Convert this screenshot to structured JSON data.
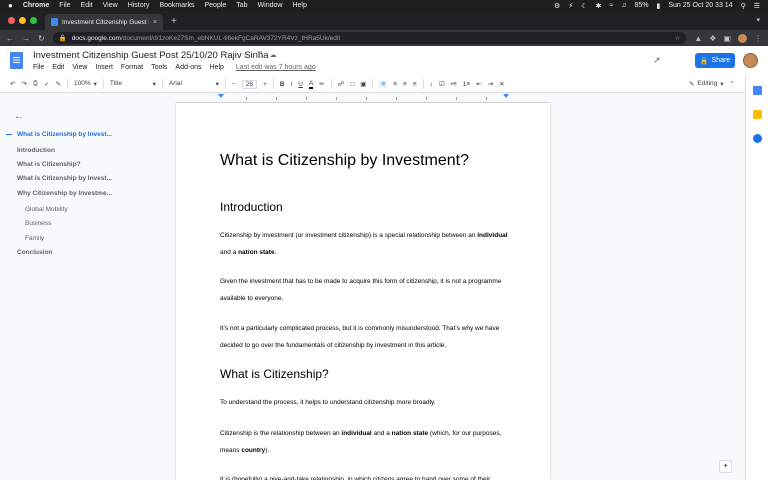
{
  "macbar": {
    "apple": "",
    "menus": [
      "Chrome",
      "File",
      "Edit",
      "View",
      "History",
      "Bookmarks",
      "People",
      "Tab",
      "Window",
      "Help"
    ],
    "battery": "85%",
    "datetime": "Sun 25 Oct  20 33 14"
  },
  "browser": {
    "tab_title": "Investment Citizenship Guest P",
    "tab_close": "×",
    "new_tab": "+",
    "url_host": "docs.google.com",
    "url_path": "/document/d/1zoKe27Sm_ebNKUL-ti6ekFgCaRAV372YR4Vz_tHRa5Uk/edit",
    "lock": "🔒"
  },
  "doc": {
    "title": "Investment Citizenship Guest Post 25/10/20 Rajiv Sinha",
    "menus": [
      "File",
      "Edit",
      "View",
      "Insert",
      "Format",
      "Tools",
      "Add-ons",
      "Help"
    ],
    "last_edit": "Last edit was 7 hours ago",
    "share_label": "Share"
  },
  "toolbar": {
    "zoom": "100%",
    "style": "Title",
    "font": "Arial",
    "size": "26",
    "minus": "−",
    "plus": "+",
    "bold": "B",
    "italic": "I",
    "underline": "U",
    "text_color": "A",
    "mode": "Editing"
  },
  "outline": {
    "back": "←",
    "items": [
      {
        "label": "What is Citizenship by Invest...",
        "level": 1,
        "active": true
      },
      {
        "label": "Introduction",
        "level": 1
      },
      {
        "label": "What is Citizenship?",
        "level": 1
      },
      {
        "label": "What is Citizenship by Invest...",
        "level": 1
      },
      {
        "label": "Why Citizenship by Investme...",
        "level": 1
      },
      {
        "label": "Global Mobility",
        "level": 2
      },
      {
        "label": "Business",
        "level": 2
      },
      {
        "label": "Family",
        "level": 2
      },
      {
        "label": "Conclusion",
        "level": 1
      }
    ]
  },
  "content": {
    "title": "What is Citizenship by Investment?",
    "h_intro": "Introduction",
    "p1_a": "Citizenship by investment (or investment citizenship) is a special relationship between an ",
    "p1_b": "individual",
    "p1_c": " and a ",
    "p1_d": "nation state",
    "p1_e": ".",
    "p2": "Given the investment that has to be made to acquire this form of citizenship, it is not a programme available to everyone.",
    "p3": "It’s not a particularly complicated process, but it is commonly misunderstood.  That’s why we have decided to go over the fundamentals of citizenship by investment in this article.",
    "h_citizenship": "What is Citizenship?",
    "p4": "To understand the process, it helps to understand citizenship more broadly.",
    "p5_a": "Citizenship is the relationship between an ",
    "p5_b": "individual",
    "p5_c": " and a ",
    "p5_d": "nation state",
    "p5_e": " (which, for our purposes, means ",
    "p5_f": "country",
    "p5_g": ").",
    "p6": "It is (hopefully) a give-and-take relationship, in which citizens agree to hand over some of their"
  },
  "colors": {
    "accent": "#1a73e8",
    "docs_blue": "#4285f4"
  }
}
